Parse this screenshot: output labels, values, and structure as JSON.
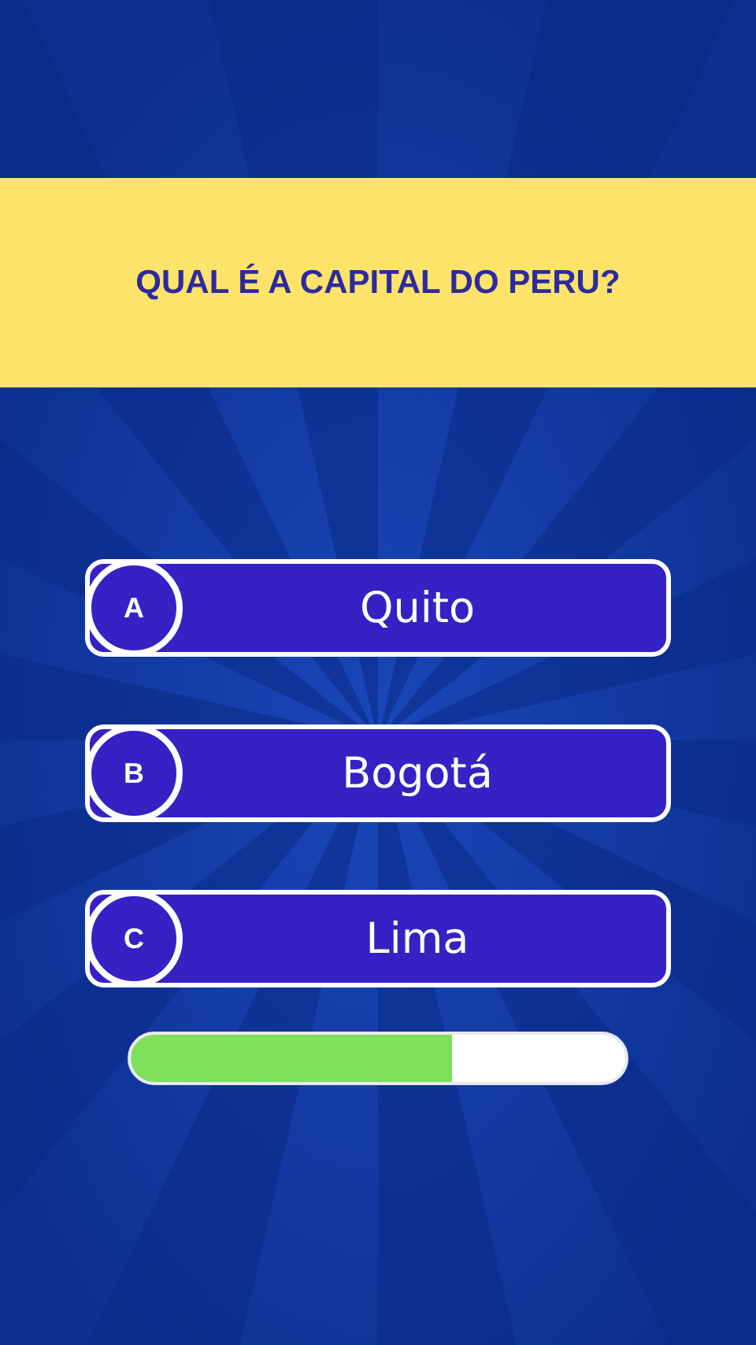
{
  "question": "QUAL É A CAPITAL DO PERU?",
  "options": [
    {
      "letter": "A",
      "text": "Quito"
    },
    {
      "letter": "B",
      "text": "Bogotá"
    },
    {
      "letter": "C",
      "text": "Lima"
    }
  ],
  "timer": {
    "level": 0.65
  }
}
